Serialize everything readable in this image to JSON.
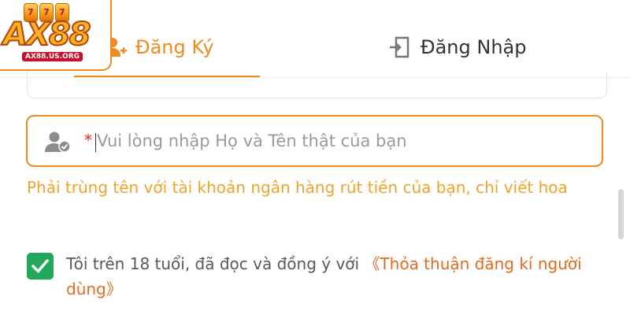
{
  "logo": {
    "text": "AX88",
    "subtitle": "AX88.US.ORG",
    "slot_digits": [
      "7",
      "7",
      "7"
    ]
  },
  "tabs": {
    "register_label": "Đăng Ký",
    "login_label": "Đăng Nhập",
    "active": "register"
  },
  "name_field": {
    "required_mark": "*",
    "placeholder": "Vui lòng nhập Họ và Tên thật của bạn",
    "value": ""
  },
  "hint": "Phải trùng tên với tài khoản ngân hàng rút tiền của bạn, chỉ viết hoa",
  "agreement": {
    "checked": true,
    "text": "Tôi trên 18 tuổi, đã đọc và đồng ý với",
    "link_text": "《Thỏa thuận đăng kí người dùng》"
  },
  "colors": {
    "accent": "#f08a1e",
    "hint": "#f0a32a",
    "check": "#22a85a",
    "required": "#e0281e",
    "link": "#e26c1d"
  },
  "icons": {
    "register_tab": "add-user-icon",
    "login_tab": "door-enter-icon",
    "name_field": "verified-user-icon",
    "checkbox": "check-icon"
  }
}
